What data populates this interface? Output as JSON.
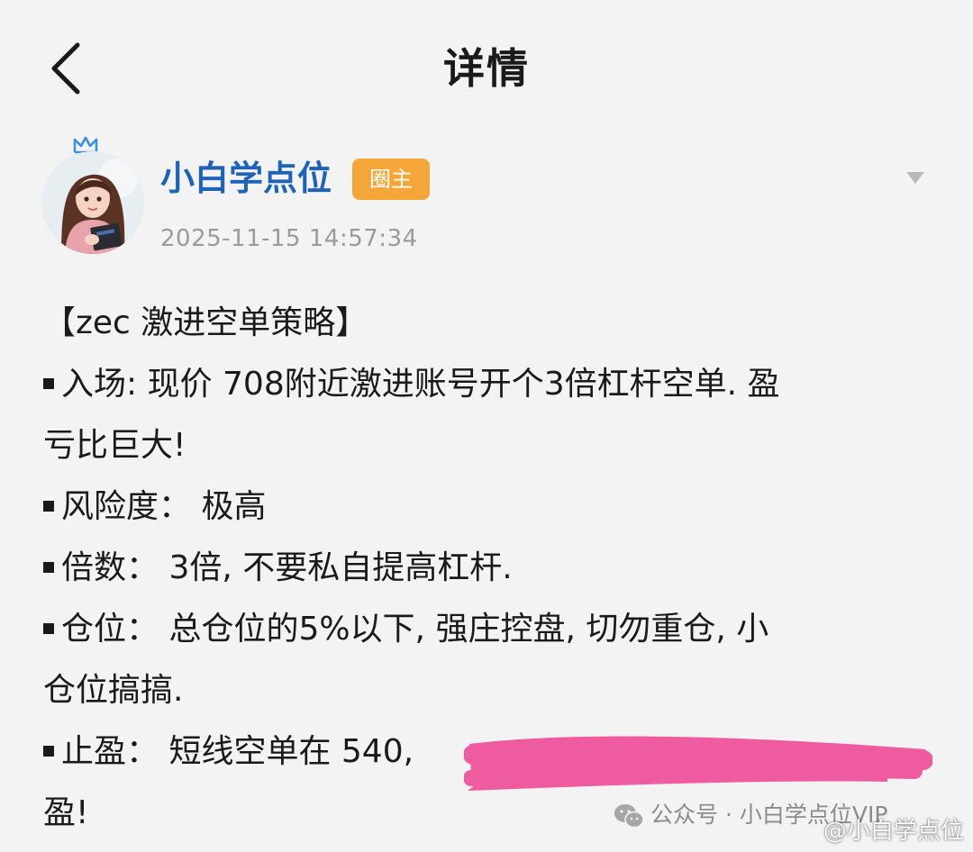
{
  "header": {
    "title": "详情",
    "back_icon": "chevron-left-icon"
  },
  "author": {
    "name": "小白学点位",
    "badge": "圈主",
    "timestamp": "2025-11-15 14:57:34",
    "avatar_icon": "avatar-girl-reading",
    "crown_icon": "crown-icon",
    "more_icon": "dropdown-arrow-icon"
  },
  "post": {
    "lines": [
      "【zec 激进空单策略】",
      "入场: 现价 708附近激进账号开个3倍杠杆空单. 盈",
      "亏比巨大!",
      "风险度： 极高",
      "倍数： 3倍, 不要私自提高杠杆.",
      "仓位： 总仓位的5%以下, 强庄控盘, 切勿重仓, 小",
      "仓位搞搞.",
      "止盈： 短线空单在 540,",
      "盈!"
    ]
  },
  "watermark": {
    "text": "公众号 · 小白学点位VIP",
    "icon": "wechat-icon"
  },
  "weibo_mark": {
    "text": "@小白学点位"
  },
  "colors": {
    "background": "#f3f3f3",
    "author_name": "#1e63b8",
    "badge": "#f5a638",
    "timestamp": "#9a9a9a",
    "redaction": "#ee5c9f"
  }
}
